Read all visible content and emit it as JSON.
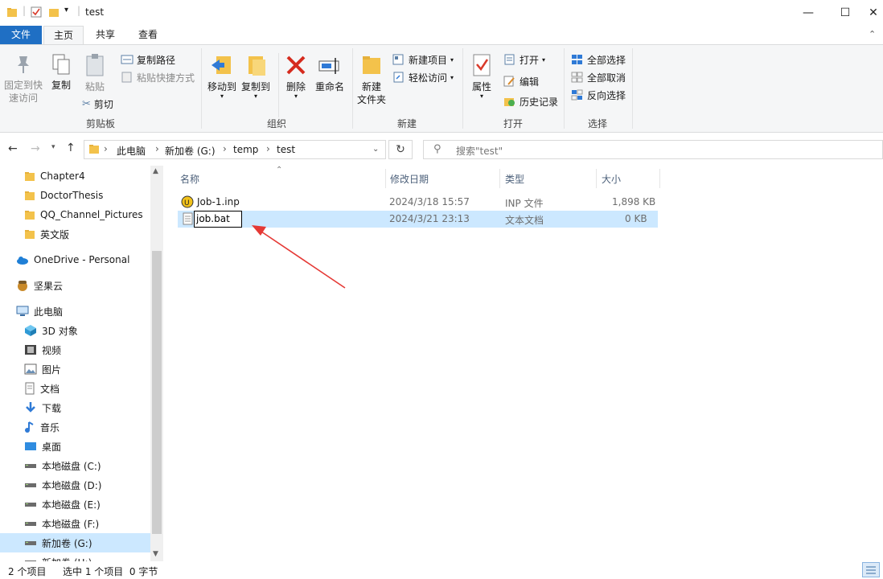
{
  "window": {
    "title": "test",
    "controls": {
      "minimize": "—",
      "maximize": "☐",
      "close": "✕"
    }
  },
  "ribbon_tabs": [
    "文件",
    "主页",
    "共享",
    "查看"
  ],
  "ribbon": {
    "clipboard": {
      "pin": [
        "固定到快",
        "速访问"
      ],
      "copy": "复制",
      "paste": "粘贴",
      "copy_path": "复制路径",
      "paste_shortcut": "粘贴快捷方式",
      "cut": "剪切",
      "label": "剪贴板"
    },
    "organize": {
      "move_to": "移动到",
      "copy_to": "复制到",
      "delete": "删除",
      "rename": "重命名",
      "label": "组织"
    },
    "new": {
      "new_folder": [
        "新建",
        "文件夹"
      ],
      "new_item": "新建项目",
      "easy_access": "轻松访问",
      "label": "新建"
    },
    "open": {
      "properties": "属性",
      "open": "打开",
      "edit": "编辑",
      "history": "历史记录",
      "label": "打开"
    },
    "select": {
      "select_all": "全部选择",
      "select_none": "全部取消",
      "invert": "反向选择",
      "label": "选择"
    }
  },
  "address": {
    "breadcrumbs": [
      "此电脑",
      "新加卷 (G:)",
      "temp",
      "test"
    ],
    "search_placeholder": "搜索\"test\""
  },
  "sidebar": {
    "items": [
      {
        "label": "Chapter4",
        "icon": "folder-icon"
      },
      {
        "label": "DoctorThesis",
        "icon": "folder-icon"
      },
      {
        "label": "QQ_Channel_Pictures",
        "icon": "folder-icon"
      },
      {
        "label": "英文版",
        "icon": "folder-icon"
      },
      {
        "label": "OneDrive - Personal",
        "icon": "cloud-icon"
      },
      {
        "label": "坚果云",
        "icon": "nut-icon"
      },
      {
        "label": "此电脑",
        "icon": "computer-icon"
      },
      {
        "label": "3D 对象",
        "icon": "cube-icon"
      },
      {
        "label": "视频",
        "icon": "video-icon"
      },
      {
        "label": "图片",
        "icon": "picture-icon"
      },
      {
        "label": "文档",
        "icon": "document-icon"
      },
      {
        "label": "下载",
        "icon": "download-icon"
      },
      {
        "label": "音乐",
        "icon": "music-icon"
      },
      {
        "label": "桌面",
        "icon": "desktop-icon"
      },
      {
        "label": "本地磁盘 (C:)",
        "icon": "drive-icon"
      },
      {
        "label": "本地磁盘 (D:)",
        "icon": "drive-icon"
      },
      {
        "label": "本地磁盘 (E:)",
        "icon": "drive-icon"
      },
      {
        "label": "本地磁盘 (F:)",
        "icon": "drive-icon"
      },
      {
        "label": "新加卷 (G:)",
        "icon": "drive-icon"
      },
      {
        "label": "新加卷 (H:)",
        "icon": "drive-icon"
      }
    ]
  },
  "filelist": {
    "columns": [
      "名称",
      "修改日期",
      "类型",
      "大小"
    ],
    "rows": [
      {
        "name": "Job-1.inp",
        "modified": "2024/3/18 15:57",
        "type": "INP 文件",
        "size": "1,898 KB"
      },
      {
        "name": "job.bat",
        "modified": "2024/3/21 23:13",
        "type": "文本文档",
        "size": "0 KB"
      }
    ]
  },
  "status": {
    "count": "2 个项目",
    "selected": "选中 1 个项目  0 字节"
  },
  "colors": {
    "accent": "#1f6fc4",
    "selection": "#cce8ff",
    "arrow": "#e53935"
  }
}
